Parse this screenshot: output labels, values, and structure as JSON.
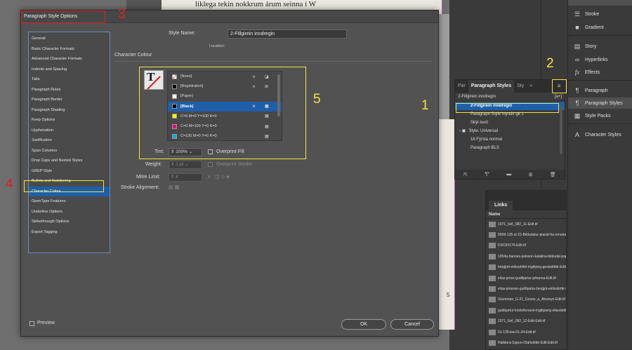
{
  "background": {
    "page_text": "liklega tekin nokkrum árum seinna í W",
    "page_number": "5"
  },
  "dock": {
    "items": [
      {
        "label": "Stroke",
        "icon": "stroke-icon",
        "active": false
      },
      {
        "label": "Gradient",
        "icon": "gradient-icon",
        "active": false
      },
      {
        "label": "Story",
        "icon": "story-icon",
        "active": false
      },
      {
        "label": "Hyperlinks",
        "icon": "hyperlinks-icon",
        "active": false
      },
      {
        "label": "Effects",
        "icon": "effects-icon",
        "active": false
      },
      {
        "label": "Paragraph",
        "icon": "paragraph-icon",
        "active": false
      },
      {
        "label": "Paragraph Styles",
        "icon": "paragraph-styles-icon",
        "active": true
      },
      {
        "label": "Style Packs",
        "icon": "style-packs-icon",
        "active": false
      },
      {
        "label": "Character Styles",
        "icon": "character-styles-icon",
        "active": false
      }
    ]
  },
  "paragraph_styles_panel": {
    "tabs": [
      "Par",
      "Paragraph Styles",
      "Sty",
      "»"
    ],
    "menu_icon": "panel-menu-icon",
    "header_left": "2-Fillgirein inndregin",
    "header_right": "[a+]",
    "items": [
      {
        "label": "2-Fillgirein inndregin",
        "selected": true
      },
      {
        "label": "Paragraph Style myndir gk 1",
        "selected": false
      },
      {
        "label": "Skýr-texti",
        "selected": false
      },
      {
        "label": "Style: Universal",
        "selected": false
      },
      {
        "label": "1b Fyrsta normal",
        "selected": false
      },
      {
        "label": "Paragraph BLS",
        "selected": false
      }
    ]
  },
  "links_panel": {
    "tab": "Links",
    "column": "Name",
    "items": [
      "1971_6s6_082_11-Edit.tif",
      "6508-135-ct-15-Bildudalur-plasid-fra-orrastaedum-Edit-Edit.tif",
      "DSC05170-Edit.tif",
      "1954q-hannes-palsson-katalina-bildudal-pap-Edit.tif",
      "bergþót-eiriksdóttir-ingibjorg-gestsdóttir-Edit.tif",
      "elias-jonss-gudbjartur-johanna-Edit.tif",
      "elias-jonsson-gudbjartur-bergjot-eiriksdottir-Edit-Edit.tif",
      "Grumman_G-21_Goose_á_Akureyri-Edit.tif",
      "gudbjartur-kristofersson-ingibjoerg-eliasdottir-Edit-Edit.tif",
      "1971_6s6_082_12-Edit-Edit.tif",
      "61-135-bw-01-34-Edit.tif",
      "Halldora-Sigrun-Olafsdóttir-Edit-Edit.tif"
    ]
  },
  "dialog": {
    "title": "Paragraph Style Options",
    "style_name_label": "Style Name:",
    "style_name_value": "2-Fillgirein inndregin",
    "location_label": "Location:",
    "section_title": "Character Colour",
    "categories": [
      {
        "label": "General",
        "selected": false
      },
      {
        "label": "Basic Character Formats",
        "selected": false
      },
      {
        "label": "Advanced Character Formats",
        "selected": false
      },
      {
        "label": "Indents and Spacing",
        "selected": false
      },
      {
        "label": "Tabs",
        "selected": false
      },
      {
        "label": "Paragraph Rules",
        "selected": false
      },
      {
        "label": "Paragraph Border",
        "selected": false
      },
      {
        "label": "Paragraph Shading",
        "selected": false
      },
      {
        "label": "Keep Options",
        "selected": false
      },
      {
        "label": "Hyphenation",
        "selected": false
      },
      {
        "label": "Justification",
        "selected": false
      },
      {
        "label": "Span Columns",
        "selected": false
      },
      {
        "label": "Drop Caps and Nested Styles",
        "selected": false
      },
      {
        "label": "GREP Style",
        "selected": false
      },
      {
        "label": "Bullets and Numbering",
        "selected": false
      },
      {
        "label": "Character Colour",
        "selected": true
      },
      {
        "label": "OpenType Features",
        "selected": false
      },
      {
        "label": "Underline Options",
        "selected": false
      },
      {
        "label": "Strikethrough Options",
        "selected": false
      },
      {
        "label": "Export Tagging",
        "selected": false
      }
    ],
    "swatches": [
      {
        "label": "[None]",
        "color": "#ffffff",
        "none": true,
        "selected": false
      },
      {
        "label": "[Registration]",
        "color": "#000000",
        "selected": false
      },
      {
        "label": "[Paper]",
        "color": "#ffffff",
        "selected": false
      },
      {
        "label": "[Black]",
        "color": "#000000",
        "selected": true
      },
      {
        "label": "C=0 M=0 Y=100 K=0",
        "color": "#fff200",
        "selected": false
      },
      {
        "label": "C=0 M=100 Y=0 K=0",
        "color": "#ec008c",
        "selected": false
      },
      {
        "label": "C=100 M=0 Y=0 K=0",
        "color": "#00aeef",
        "selected": false
      }
    ],
    "tint_label": "Tint:",
    "tint_value": "100%",
    "overprint_fill_label": "Overprint Fill",
    "weight_label": "Weight:",
    "weight_value": "1 pt",
    "overprint_stroke_label": "Overprint Stroke",
    "mitre_label": "Mitre Limit:",
    "mitre_value": "4",
    "mitre_x": "x",
    "stroke_alignment_label": "Stroke Alignment:",
    "preview_label": "Preview",
    "ok_label": "OK",
    "cancel_label": "Cancel"
  },
  "annotations": {
    "n1": "1",
    "n2": "2",
    "n3": "3",
    "n4": "4",
    "n5": "5"
  },
  "colors": {
    "annotation_red": "#e02020",
    "annotation_yellow": "#f0e640",
    "selection_blue": "#1e5fa8"
  }
}
